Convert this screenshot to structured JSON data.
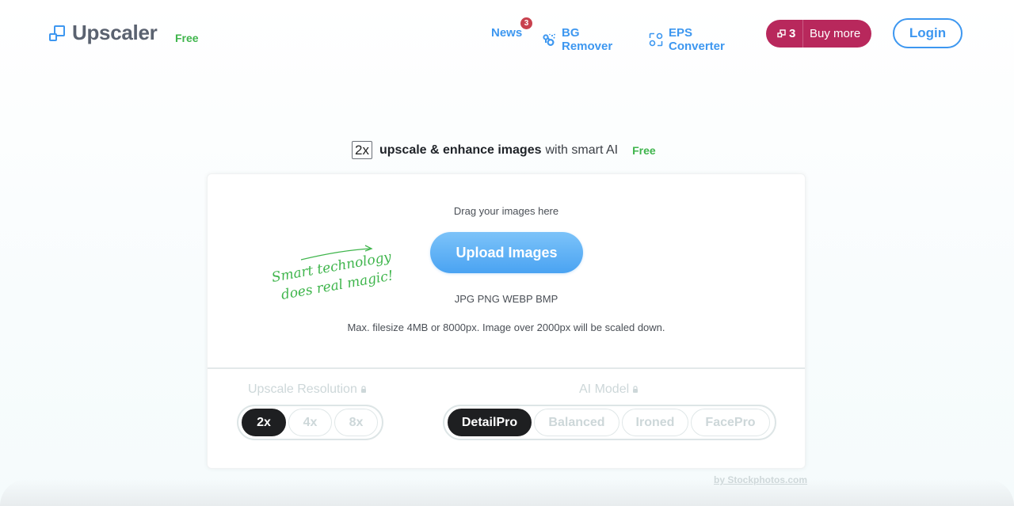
{
  "header": {
    "logo_text": "Upscaler",
    "logo_badge": "Free",
    "nav": [
      {
        "label": "News",
        "badge": "3",
        "icon": "news"
      },
      {
        "label": "BG Remover",
        "icon": "bg-remover-icon"
      },
      {
        "label": "EPS Converter",
        "icon": "eps-converter-icon"
      }
    ],
    "buy": {
      "credits": "3",
      "label": "Buy more",
      "icon": "credits-icon"
    },
    "login_label": "Login"
  },
  "headline": {
    "scale": "2x",
    "bold_text": "upscale & enhance images",
    "normal_text": "with smart AI",
    "badge": "Free"
  },
  "upload": {
    "drag_text": "Drag your images here",
    "button_label": "Upload Images",
    "formats": "JPG PNG WEBP BMP",
    "limits": "Max. filesize 4MB or 8000px. Image over 2000px will be scaled down.",
    "tagline_line1": "Smart technology",
    "tagline_line2": "does real magic!"
  },
  "options": {
    "resolution": {
      "label": "Upscale Resolution",
      "locked": true,
      "choices": [
        "2x",
        "4x",
        "8x"
      ],
      "selected": "2x"
    },
    "model": {
      "label": "AI Model",
      "locked": true,
      "choices": [
        "DetailPro",
        "Balanced",
        "Ironed",
        "FacePro"
      ],
      "selected": "DetailPro"
    }
  },
  "footer": {
    "credit": "by Stockphotos.com"
  },
  "colors": {
    "accent": "#3d97f0",
    "free_green": "#3fb54c",
    "buy_button": "#b8285c",
    "badge_red": "#c8414e",
    "active_pill": "#1e1f21"
  }
}
